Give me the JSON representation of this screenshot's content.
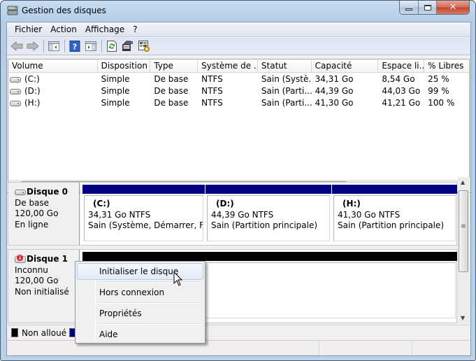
{
  "window": {
    "title": "Gestion des disques",
    "controls": {
      "minimize": "minimize",
      "maximize": "maximize",
      "close": "close"
    }
  },
  "menubar": {
    "items": [
      "Fichier",
      "Action",
      "Affichage",
      "?"
    ]
  },
  "toolbar": {
    "buttons": [
      "back-arrow-icon",
      "forward-arrow-icon",
      "show-hide-console-tree-icon",
      "help-icon",
      "show-hide-action-pane-icon",
      "refresh-icon",
      "rescan-disks-icon",
      "properties-icon"
    ]
  },
  "volume_list": {
    "columns": [
      "Volume",
      "Disposition",
      "Type",
      "Système de ...",
      "Statut",
      "Capacité",
      "Espace li...",
      "% Libres"
    ],
    "rows": [
      [
        "(C:)",
        "Simple",
        "De base",
        "NTFS",
        "Sain (Systè...",
        "34,31 Go",
        "8,54 Go",
        "25 %"
      ],
      [
        "(D:)",
        "Simple",
        "De base",
        "NTFS",
        "Sain (Parti...",
        "44,39 Go",
        "44,03 Go",
        "99 %"
      ],
      [
        "(H:)",
        "Simple",
        "De base",
        "NTFS",
        "Sain (Parti...",
        "41,30 Go",
        "41,21 Go",
        "100 %"
      ]
    ],
    "hscroll_grip": "III"
  },
  "disks": [
    {
      "name": "Disque 0",
      "type": "De base",
      "size": "120,00 Go",
      "status": "En ligne",
      "partitions": [
        {
          "name": "(C:)",
          "size_fs": "34,31 Go NTFS",
          "status": "Sain (Système, Démarrer, Fichi",
          "color": "#000080"
        },
        {
          "name": "(D:)",
          "size_fs": "44,39 Go NTFS",
          "status": "Sain (Partition principale)",
          "color": "#000080"
        },
        {
          "name": "(H:)",
          "size_fs": "41,30 Go NTFS",
          "status": "Sain (Partition principale)",
          "color": "#000080"
        }
      ]
    },
    {
      "name": "Disque 1",
      "type": "Inconnu",
      "size": "120,00 Go",
      "status": "Non initialisé",
      "partitions": [
        {
          "name": "",
          "size_fs": "",
          "status": "",
          "color": "#000000"
        }
      ]
    }
  ],
  "legend": {
    "items": [
      {
        "label": "Non alloué",
        "color": "#000000"
      },
      {
        "label": "",
        "color": "#000080"
      }
    ]
  },
  "context_menu": {
    "items": [
      "Initialiser le disque",
      "Hors connexion",
      "Propriétés",
      "Aide"
    ],
    "highlighted": "Initialiser le disque"
  }
}
